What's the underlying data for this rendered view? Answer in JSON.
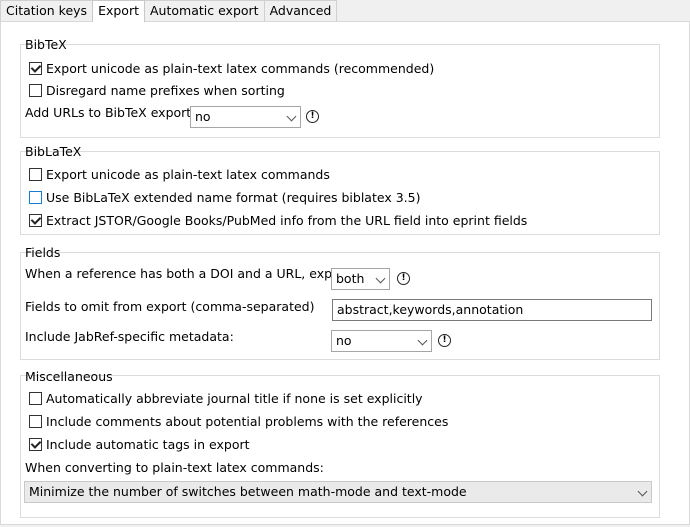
{
  "tabs": [
    {
      "label": "Citation keys",
      "active": false
    },
    {
      "label": "Export",
      "active": true
    },
    {
      "label": "Automatic export",
      "active": false
    },
    {
      "label": "Advanced",
      "active": false
    }
  ],
  "bibtex": {
    "title": "BibTeX",
    "export_unicode": {
      "label": "Export unicode as plain-text latex commands (recommended)",
      "checked": true
    },
    "disregard_prefixes": {
      "label": "Disregard name prefixes when sorting",
      "checked": false
    },
    "add_urls_label": "Add URLs to BibTeX export",
    "add_urls_value": "no"
  },
  "biblatex": {
    "title": "BibLaTeX",
    "export_unicode": {
      "label": "Export unicode as plain-text latex commands",
      "checked": false
    },
    "extended_name": {
      "label": "Use BibLaTeX extended name format (requires biblatex 3.5)",
      "checked": false
    },
    "extract_jstor": {
      "label": "Extract JSTOR/Google Books/PubMed info from the URL field into eprint fields",
      "checked": true
    }
  },
  "fields": {
    "title": "Fields",
    "doi_url_label": "When a reference has both a DOI and a URL, export",
    "doi_url_value": "both",
    "omit_label": "Fields to omit from export (comma-separated)",
    "omit_value": "abstract,keywords,annotation",
    "jabref_label": "Include JabRef-specific metadata:",
    "jabref_value": "no"
  },
  "misc": {
    "title": "Miscellaneous",
    "abbreviate": {
      "label": "Automatically abbreviate journal title if none is set explicitly",
      "checked": false
    },
    "comments": {
      "label": "Include comments about potential problems with the references",
      "checked": false
    },
    "auto_tags": {
      "label": "Include automatic tags in export",
      "checked": true
    },
    "converting_label": "When converting to plain-text latex commands:",
    "converting_value": "Minimize the number of switches between math-mode and text-mode"
  },
  "info_glyph": "!"
}
